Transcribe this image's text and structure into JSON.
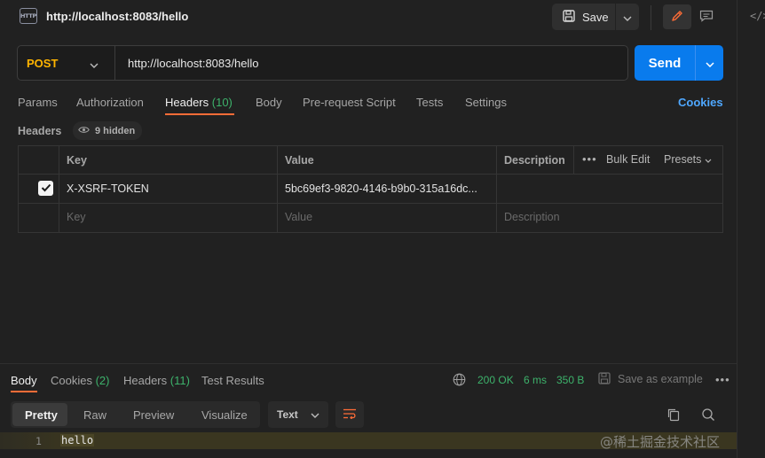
{
  "request": {
    "title": "http://localhost:8083/hello",
    "icon_text": "HTTP",
    "method": "POST",
    "url": "http://localhost:8083/hello"
  },
  "toolbar": {
    "save_label": "Save",
    "send_label": "Send"
  },
  "tabs": [
    {
      "label": "Params"
    },
    {
      "label": "Authorization"
    },
    {
      "label": "Headers",
      "count": "(10)",
      "active": true
    },
    {
      "label": "Body"
    },
    {
      "label": "Pre-request Script"
    },
    {
      "label": "Tests"
    },
    {
      "label": "Settings"
    }
  ],
  "cookies_label": "Cookies",
  "headers_section": {
    "label": "Headers",
    "hidden_label": "9 hidden",
    "columns": {
      "key": "Key",
      "value": "Value",
      "description": "Description"
    },
    "bulk_edit": "Bulk Edit",
    "presets": "Presets",
    "rows": [
      {
        "checked": true,
        "key": "X-XSRF-TOKEN",
        "value": "5bc69ef3-9820-4146-b9b0-315a16dc...",
        "description": ""
      }
    ],
    "placeholders": {
      "key": "Key",
      "value": "Value",
      "description": "Description"
    }
  },
  "response": {
    "tabs": [
      {
        "label": "Body",
        "active": true
      },
      {
        "label": "Cookies",
        "count": "(2)"
      },
      {
        "label": "Headers",
        "count": "(11)"
      },
      {
        "label": "Test Results"
      }
    ],
    "status": "200 OK",
    "time": "6 ms",
    "size": "350 B",
    "save_example": "Save as example",
    "view_tabs": [
      "Pretty",
      "Raw",
      "Preview",
      "Visualize"
    ],
    "format": "Text",
    "lines": [
      {
        "number": "1",
        "text": "hello"
      }
    ]
  },
  "watermark": "@稀土掘金技术社区",
  "colors": {
    "method": "#ffb400",
    "send": "#097bed",
    "active_tab_underline": "#ff6c37",
    "count": "#3db26b",
    "link": "#4fa8ff"
  }
}
